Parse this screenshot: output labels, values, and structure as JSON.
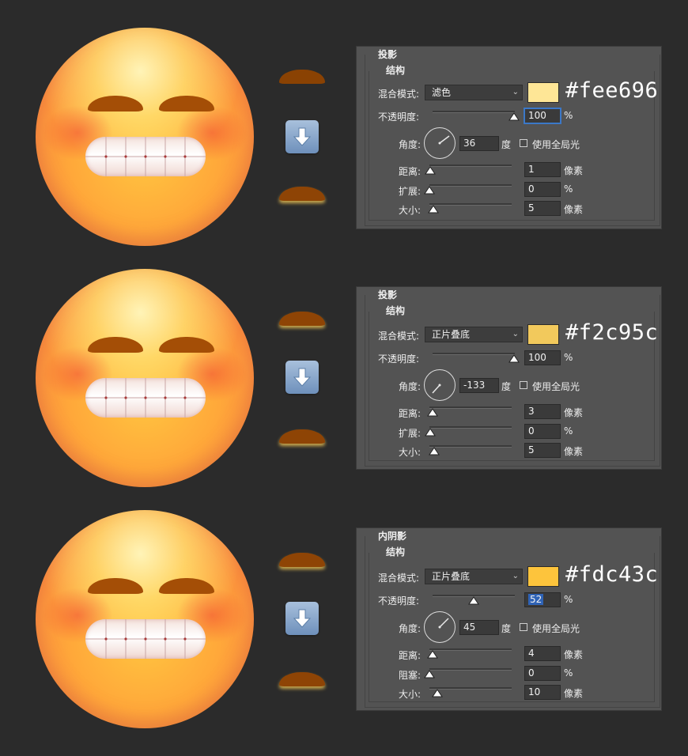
{
  "panels": [
    {
      "title": "投影",
      "section": "结构",
      "blend_label": "混合模式:",
      "blend_mode": "滤色",
      "color": "#fee696",
      "hex_text": "#fee696",
      "opacity_label": "不透明度:",
      "opacity_value": "100",
      "opacity_unit": "%",
      "angle_label": "角度:",
      "angle_value": "36",
      "angle_unit": "度",
      "global_light_label": "使用全局光",
      "rows": [
        {
          "label": "距离:",
          "value": "1",
          "unit": "像素"
        },
        {
          "label": "扩展:",
          "value": "0",
          "unit": "%"
        },
        {
          "label": "大小:",
          "value": "5",
          "unit": "像素"
        }
      ]
    },
    {
      "title": "投影",
      "section": "结构",
      "blend_label": "混合模式:",
      "blend_mode": "正片叠底",
      "color": "#f2c95c",
      "hex_text": "#f2c95c",
      "opacity_label": "不透明度:",
      "opacity_value": "100",
      "opacity_unit": "%",
      "angle_label": "角度:",
      "angle_value": "-133",
      "angle_unit": "度",
      "global_light_label": "使用全局光",
      "rows": [
        {
          "label": "距离:",
          "value": "3",
          "unit": "像素"
        },
        {
          "label": "扩展:",
          "value": "0",
          "unit": "%"
        },
        {
          "label": "大小:",
          "value": "5",
          "unit": "像素"
        }
      ]
    },
    {
      "title": "内阴影",
      "section": "结构",
      "blend_label": "混合模式:",
      "blend_mode": "正片叠底",
      "color": "#fdc43c",
      "hex_text": "#fdc43c",
      "opacity_label": "不透明度:",
      "opacity_value": "52",
      "opacity_unit": "%",
      "angle_label": "角度:",
      "angle_value": "45",
      "angle_unit": "度",
      "global_light_label": "使用全局光",
      "rows": [
        {
          "label": "距离:",
          "value": "4",
          "unit": "像素"
        },
        {
          "label": "阻塞:",
          "value": "0",
          "unit": "%"
        },
        {
          "label": "大小:",
          "value": "10",
          "unit": "像素"
        }
      ]
    }
  ],
  "icons": {
    "arrow": "arrow-down-icon",
    "dropdown": "chevron-down-icon"
  }
}
